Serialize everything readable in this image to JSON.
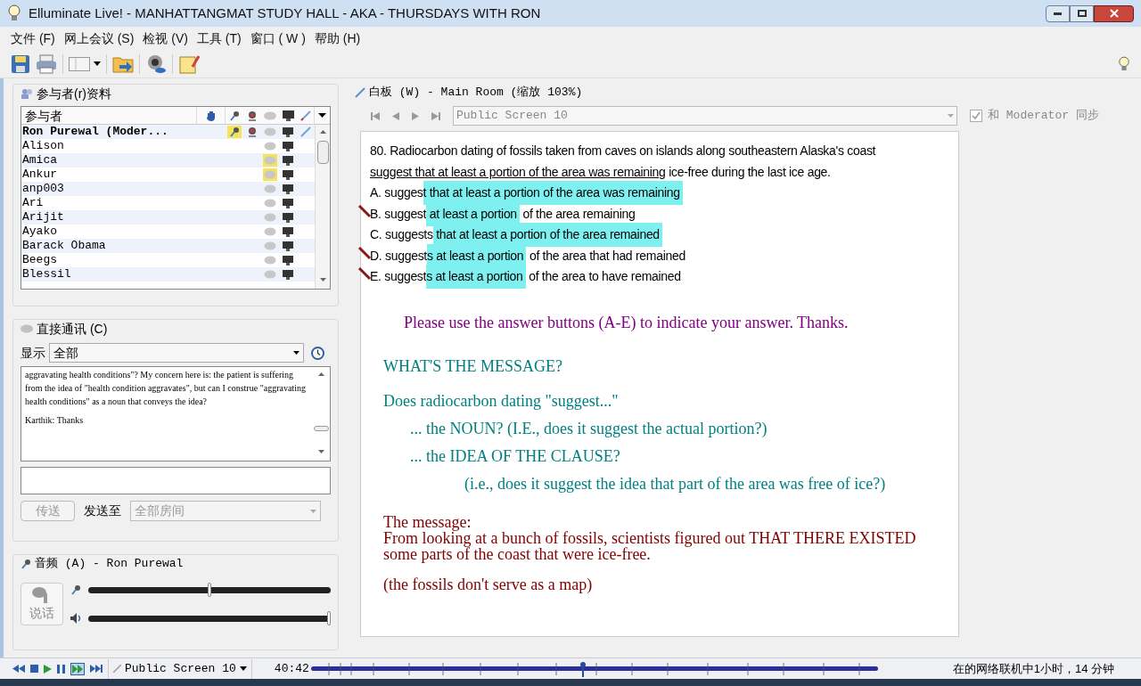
{
  "window": {
    "title": "Elluminate Live! - MANHATTANGMAT STUDY HALL - AKA - THURSDAYS WITH RON"
  },
  "menu": [
    "文件 (F)",
    "网上会议 (S)",
    "检视 (V)",
    "工具 (T)",
    "窗口 ( W )",
    "帮助 (H)"
  ],
  "participants": {
    "title": "参与者(r)资料",
    "column": "参与者",
    "rows": [
      {
        "name": "Ron Purewal (Moder...",
        "moderator": true,
        "mic": true,
        "camera": true,
        "speaking": false,
        "pen": true
      },
      {
        "name": "Alison",
        "moderator": false,
        "mic": false,
        "camera": false,
        "speaking": false,
        "pen": false
      },
      {
        "name": "Amica",
        "moderator": false,
        "mic": false,
        "camera": false,
        "speaking": true,
        "pen": false
      },
      {
        "name": "Ankur",
        "moderator": false,
        "mic": false,
        "camera": false,
        "speaking": true,
        "pen": false
      },
      {
        "name": "anp003",
        "moderator": false,
        "mic": false,
        "camera": false,
        "speaking": false,
        "pen": false
      },
      {
        "name": "Ari",
        "moderator": false,
        "mic": false,
        "camera": false,
        "speaking": false,
        "pen": false
      },
      {
        "name": "Arijit",
        "moderator": false,
        "mic": false,
        "camera": false,
        "speaking": false,
        "pen": false
      },
      {
        "name": "Ayako",
        "moderator": false,
        "mic": false,
        "camera": false,
        "speaking": false,
        "pen": false
      },
      {
        "name": "Barack Obama",
        "moderator": false,
        "mic": false,
        "camera": false,
        "speaking": false,
        "pen": false
      },
      {
        "name": "Beegs",
        "moderator": false,
        "mic": false,
        "camera": false,
        "speaking": false,
        "pen": false
      },
      {
        "name": "Blessil",
        "moderator": false,
        "mic": false,
        "camera": false,
        "speaking": false,
        "pen": false
      }
    ]
  },
  "chat": {
    "title": "直接通讯 (C)",
    "show_label": "显示",
    "show_value": "全部",
    "messages": [
      "aggravating health conditions\"? My concern here is: the patient is suffering from the idea of \"health condition aggravates\", but can I construe \"aggravating health conditions\" as a noun that conveys the idea?",
      "Karthik: Thanks"
    ],
    "send_button": "传送",
    "send_to_label": "发送至",
    "send_to_value": "全部房间"
  },
  "audio": {
    "title": "音频 (A) - Ron Purewal",
    "talk_button": "说话",
    "mic": {
      "level": 0.5
    },
    "speaker": {
      "level": 1.0
    }
  },
  "whiteboard": {
    "title": "白板 (W) - Main Room (缩放 103%)",
    "screen": "Public Screen 10",
    "sync_checked": true,
    "sync_label": "和 Moderator 同步",
    "question": {
      "text": "80. Radiocarbon dating of fossils taken from caves on islands along southeastern Alaska's coast ",
      "underlined": "suggest that at least a portion of the area was remaining",
      "rest": " ice-free during the last ice age."
    },
    "answers": [
      {
        "before": "A. sugges",
        "highlight": "t that at least a portion of the area was remaining",
        "crossed": false
      },
      {
        "before": "B. suggest",
        "highlight": " at least a portion",
        "after": " of the area remaining",
        "crossed": true
      },
      {
        "before": "C. suggests",
        "highlight": " that at least a portion of the area remained",
        "crossed": false
      },
      {
        "before": "D. suggest",
        "highlight": "s at least a portion",
        "after": " of the area that had remained",
        "crossed": true
      },
      {
        "before": "E. suggest",
        "highlight": "s at least a portion",
        "after": " of the area to have remained",
        "crossed": true
      }
    ],
    "notes": [
      {
        "text": "Please use the answer buttons (A-E) to indicate your answer.  Thanks.",
        "color": "#800080"
      },
      {
        "text": "WHAT'S THE MESSAGE?",
        "color": "#008080"
      },
      {
        "text": "Does radiocarbon dating \"suggest...\"",
        "color": "#008080",
        "children": [
          {
            "text": "... the NOUN?   (I.E., does it suggest the actual portion?)",
            "color": "#008080"
          },
          {
            "text": "... the IDEA OF THE CLAUSE?",
            "color": "#008080",
            "children": [
              {
                "text": "(i.e., does it suggest the idea that part of the area was free of ice?)",
                "color": "#008080"
              }
            ]
          }
        ]
      },
      {
        "text": "The message:",
        "color": "#800000"
      },
      {
        "text": "From looking at a bunch of fossils, scientists figured out THAT THERE EXISTED some parts of the coast that were ice-free.",
        "color": "#800000"
      },
      {
        "text": "(the fossils don't serve as a map)",
        "color": "#800000"
      }
    ]
  },
  "playback": {
    "screen": "Public Screen 10",
    "time": "40:42",
    "level": 0.48
  },
  "status": "在的网络联机中1小时，14 分钟"
}
